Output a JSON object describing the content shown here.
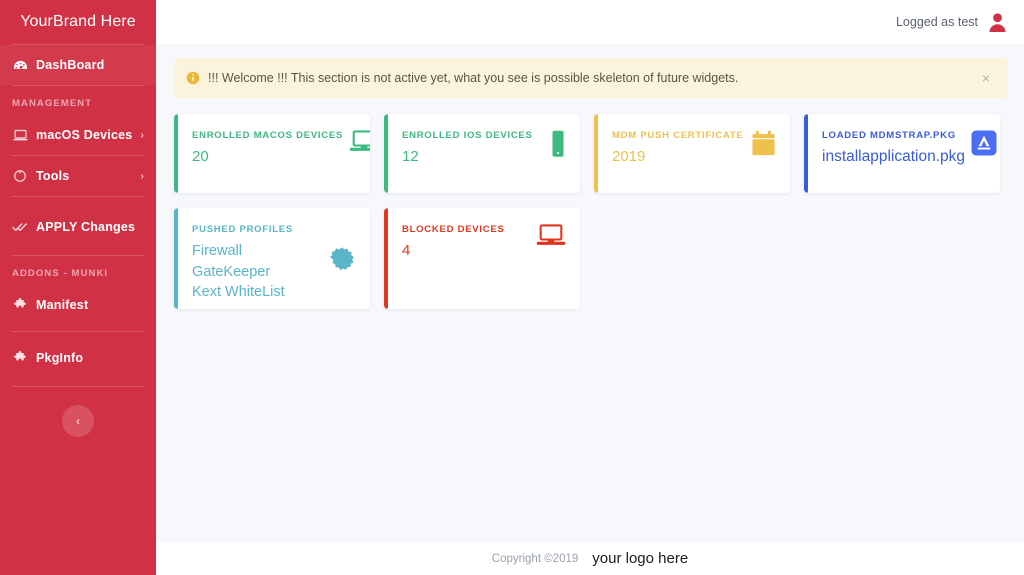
{
  "brand": {
    "title": "YourBrand Here"
  },
  "sidebar": {
    "dashboard": {
      "label": "DashBoard",
      "icon": "dashboard-icon"
    },
    "section_management": "MANAGEMENT",
    "section_addons": "ADDONS - MUNKI",
    "items": [
      {
        "label": "macOS Devices",
        "icon": "laptop-icon",
        "chevron": "›"
      },
      {
        "label": "Tools",
        "icon": "gear-icon",
        "chevron": "›"
      },
      {
        "label": "APPLY Changes",
        "icon": "check-double-icon",
        "chevron": ""
      },
      {
        "label": "Manifest",
        "icon": "puzzle-piece-icon",
        "chevron": ""
      },
      {
        "label": "PkgInfo",
        "icon": "puzzle-piece-icon",
        "chevron": ""
      }
    ],
    "collapse": {
      "label": "‹"
    },
    "background_color": "#d13144"
  },
  "topbar": {
    "logged_as": "Logged as test",
    "avatar_icon": "user-avatar-icon"
  },
  "alert": {
    "icon": "info-circle-icon",
    "text": "!!! Welcome !!! This section is not active yet, what you see is possible skeleton of future widgets.",
    "close_label": "×",
    "background_color": "#fcf3dc"
  },
  "cards": [
    {
      "title": "ENROLLED MACOS DEVICES",
      "value": "20",
      "icon": "laptop-icon",
      "color": "#3dba7f",
      "variant": "value"
    },
    {
      "title": "ENROLLED IOS DEVICES",
      "value": "12",
      "icon": "mobile-phone-icon",
      "color": "#3dba7f",
      "variant": "value"
    },
    {
      "title": "MDM PUSH CERTIFICATE",
      "value": "2019",
      "icon": "calendar-icon",
      "color": "#eec14c",
      "variant": "value"
    },
    {
      "title": "LOADED MDMSTRAP.PKG",
      "value": "installapplication.pkg",
      "icon": "app-store-icon",
      "color": "#3b5bdb",
      "variant": "value"
    },
    {
      "title": "PUSHED PROFILES",
      "list": [
        "Firewall",
        "GateKeeper",
        "Kext WhiteList"
      ],
      "icon": "certificate-badge-icon",
      "color": "#5ab5c8",
      "variant": "list"
    },
    {
      "title": "BLOCKED DEVICES",
      "value": "4",
      "icon": "laptop-blocked-icon",
      "color": "#e0361f",
      "variant": "value"
    }
  ],
  "footer": {
    "copyright": "Copyright ©2019",
    "logo_text": "your logo here"
  }
}
